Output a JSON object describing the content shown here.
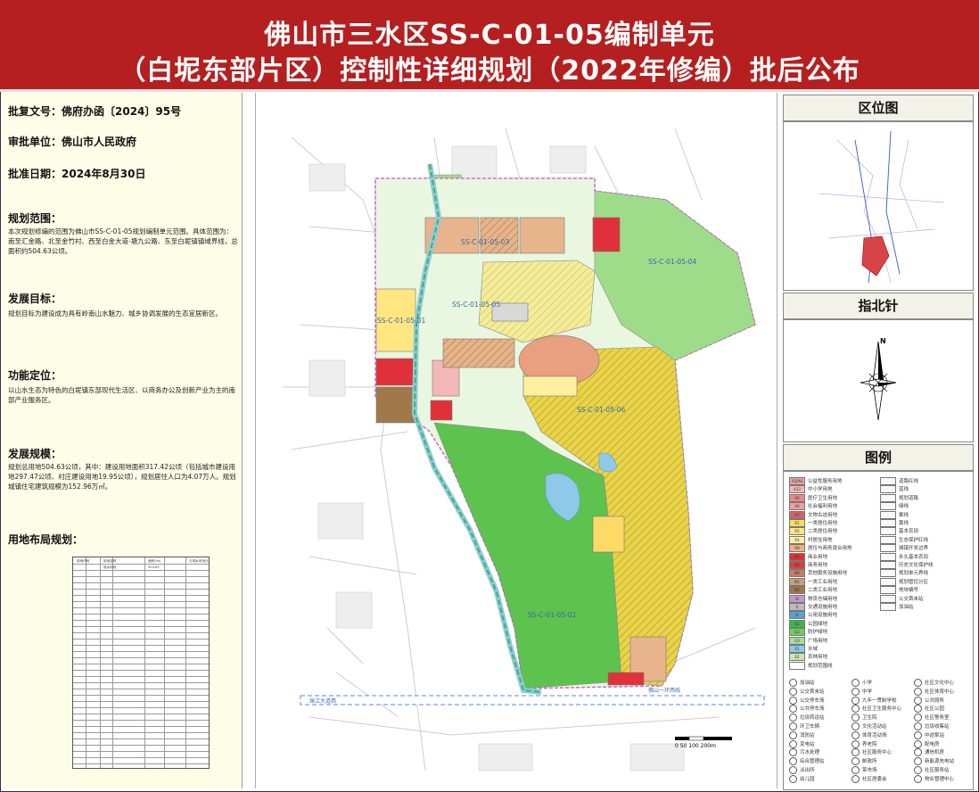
{
  "header": {
    "title_line1": "佛山市三水区SS-C-01-05编制单元",
    "title_line2": "（白坭东部片区）控制性详细规划（2022年修编）批后公布"
  },
  "approval": {
    "doc_no": "批复文号：佛府办函〔2024〕95号",
    "unit": "审批单位：佛山市人民政府",
    "date": "批准日期：2024年8月30日"
  },
  "sections": {
    "scope_title": "规划范围：",
    "scope_text": "本次规划修编的范围为佛山市SS-C-01-05规划编制单元范围。具体范围为：南至汇金路、北至金竹村、西至白金大道-塘九公路、东至白坭镇镇域界线，总面积约504.63公顷。",
    "goal_title": "发展目标：",
    "goal_text": "规划目标为建设成为具有岭南山水魅力、城乡协调发展的生态宜居新区。",
    "function_title": "功能定位：",
    "function_text": "以山水生态为特色的白坭镇东部现代生活区、以商务办公及创新产业为主的南部产业服务区。",
    "scale_title": "发展规模：",
    "scale_text": "规划总用地504.63公顷，其中：建设用地面积317.42公顷（包括城市建设用地297.47公顷、村庄建设用地19.95公顷），规划居住人口为4.07万人。规划城镇住宅建筑规模为152.96万㎡。",
    "landuse_title": "用地布局规划："
  },
  "right": {
    "location_title": "区位图",
    "north_title": "指北针",
    "north_letter": "N",
    "legend_title": "图例"
  },
  "map_labels": {
    "unit_01": "SS-C-01-05-01",
    "unit_02": "SS-C-01-05-02",
    "unit_03": "SS-C-01-05-03",
    "unit_04": "SS-C-01-05-04",
    "unit_05": "SS-C-01-05-05",
    "unit_06": "SS-C-01-05-06",
    "road_south": "珠江大道西",
    "road_bottom": "佛山一环西线",
    "scale_bar": "0 50 100 200m"
  },
  "legend": [
    {
      "code": "A3/A4",
      "label": "公益性服务用地",
      "color": "#e8a0a0"
    },
    {
      "code": "A33",
      "label": "中小学用地",
      "color": "#f2b8b8"
    },
    {
      "code": "A5",
      "label": "医疗卫生用地",
      "color": "#e88a8a"
    },
    {
      "code": "A6",
      "label": "社会福利用地",
      "color": "#f0a0a0"
    },
    {
      "code": "A7",
      "label": "文物古迹用地",
      "color": "#cc6666"
    },
    {
      "code": "R1",
      "label": "一类居住用地",
      "color": "#ffd966"
    },
    {
      "code": "R2",
      "label": "二类居住用地",
      "color": "#ffe680"
    },
    {
      "code": "R4",
      "label": "村居住用地",
      "color": "#fff0a0"
    },
    {
      "code": "RB",
      "label": "居住与商务混合用地",
      "color": "#f4b183"
    },
    {
      "code": "B1",
      "label": "商业用地",
      "color": "#e0313a"
    },
    {
      "code": "B2",
      "label": "商务用地",
      "color": "#d4433a"
    },
    {
      "code": "B9",
      "label": "其他服务设施用地",
      "color": "#c97a6a"
    },
    {
      "code": "M1",
      "label": "一类工业用地",
      "color": "#c8a07a"
    },
    {
      "code": "M2",
      "label": "二类工业用地",
      "color": "#a0784a"
    },
    {
      "code": "W",
      "label": "物流仓储用地",
      "color": "#c09ad0"
    },
    {
      "code": "S",
      "label": "交通设施用地",
      "color": "#bbbbbb"
    },
    {
      "code": "U",
      "label": "公用设施用地",
      "color": "#5aa0d0"
    },
    {
      "code": "G1",
      "label": "公园绿地",
      "color": "#3cb84a"
    },
    {
      "code": "G2",
      "label": "防护绿地",
      "color": "#6fcf5c"
    },
    {
      "code": "G3",
      "label": "广场用地",
      "color": "#a8dca0"
    },
    {
      "code": "E1",
      "label": "水域",
      "color": "#8fc8e8"
    },
    {
      "code": "E2",
      "label": "农林用地",
      "color": "#c8e6b0"
    },
    {
      "code": "",
      "label": "规划范围线",
      "color": "#ffffff"
    }
  ],
  "legend_right": [
    "道路红线",
    "蓝线",
    "规划道路",
    "绿线",
    "紫线",
    "黄线",
    "基本农田",
    "生态保护红线",
    "城镇开发边界",
    "永久基本农田",
    "历史文化保护线",
    "规划单元界线",
    "规划管控分区",
    "地块编号",
    "公交首末站",
    "加油站"
  ],
  "facilities": [
    "加油站",
    "公交首末站",
    "公交停车场",
    "公共停车场",
    "垃圾转运站",
    "环卫车辆",
    "消防站",
    "变电站",
    "污水处理",
    "综合管理站",
    "派出所",
    "幼儿园",
    "小学",
    "中学",
    "九年一贯制学校",
    "社区卫生服务中心",
    "卫生院",
    "文化活动站",
    "体育活动场",
    "养老院",
    "社区服务中心",
    "邮政所",
    "菜市场",
    "社区居委会",
    "社区文化中心",
    "社区体育中心",
    "公共厕所",
    "社区公园",
    "社区警务室",
    "垃圾收集站",
    "中途泵站",
    "配电房",
    "通信机房",
    "新能源充电站",
    "社区服务站",
    "物业管理中心"
  ],
  "land_table": {
    "headers": [
      "用地代码",
      "用地名称",
      "面积(ha)",
      "占城乡用地比例(%)"
    ],
    "total_label": "城乡用地",
    "total_area": "504.63"
  }
}
